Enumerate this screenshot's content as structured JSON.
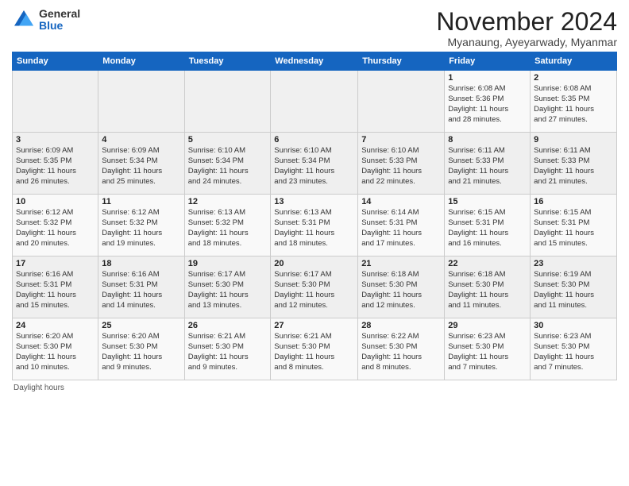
{
  "logo": {
    "general": "General",
    "blue": "Blue"
  },
  "header": {
    "month": "November 2024",
    "location": "Myanaung, Ayeyarwady, Myanmar"
  },
  "weekdays": [
    "Sunday",
    "Monday",
    "Tuesday",
    "Wednesday",
    "Thursday",
    "Friday",
    "Saturday"
  ],
  "footer": "Daylight hours",
  "weeks": [
    [
      {
        "day": "",
        "info": ""
      },
      {
        "day": "",
        "info": ""
      },
      {
        "day": "",
        "info": ""
      },
      {
        "day": "",
        "info": ""
      },
      {
        "day": "",
        "info": ""
      },
      {
        "day": "1",
        "info": "Sunrise: 6:08 AM\nSunset: 5:36 PM\nDaylight: 11 hours\nand 28 minutes."
      },
      {
        "day": "2",
        "info": "Sunrise: 6:08 AM\nSunset: 5:35 PM\nDaylight: 11 hours\nand 27 minutes."
      }
    ],
    [
      {
        "day": "3",
        "info": "Sunrise: 6:09 AM\nSunset: 5:35 PM\nDaylight: 11 hours\nand 26 minutes."
      },
      {
        "day": "4",
        "info": "Sunrise: 6:09 AM\nSunset: 5:34 PM\nDaylight: 11 hours\nand 25 minutes."
      },
      {
        "day": "5",
        "info": "Sunrise: 6:10 AM\nSunset: 5:34 PM\nDaylight: 11 hours\nand 24 minutes."
      },
      {
        "day": "6",
        "info": "Sunrise: 6:10 AM\nSunset: 5:34 PM\nDaylight: 11 hours\nand 23 minutes."
      },
      {
        "day": "7",
        "info": "Sunrise: 6:10 AM\nSunset: 5:33 PM\nDaylight: 11 hours\nand 22 minutes."
      },
      {
        "day": "8",
        "info": "Sunrise: 6:11 AM\nSunset: 5:33 PM\nDaylight: 11 hours\nand 21 minutes."
      },
      {
        "day": "9",
        "info": "Sunrise: 6:11 AM\nSunset: 5:33 PM\nDaylight: 11 hours\nand 21 minutes."
      }
    ],
    [
      {
        "day": "10",
        "info": "Sunrise: 6:12 AM\nSunset: 5:32 PM\nDaylight: 11 hours\nand 20 minutes."
      },
      {
        "day": "11",
        "info": "Sunrise: 6:12 AM\nSunset: 5:32 PM\nDaylight: 11 hours\nand 19 minutes."
      },
      {
        "day": "12",
        "info": "Sunrise: 6:13 AM\nSunset: 5:32 PM\nDaylight: 11 hours\nand 18 minutes."
      },
      {
        "day": "13",
        "info": "Sunrise: 6:13 AM\nSunset: 5:31 PM\nDaylight: 11 hours\nand 18 minutes."
      },
      {
        "day": "14",
        "info": "Sunrise: 6:14 AM\nSunset: 5:31 PM\nDaylight: 11 hours\nand 17 minutes."
      },
      {
        "day": "15",
        "info": "Sunrise: 6:15 AM\nSunset: 5:31 PM\nDaylight: 11 hours\nand 16 minutes."
      },
      {
        "day": "16",
        "info": "Sunrise: 6:15 AM\nSunset: 5:31 PM\nDaylight: 11 hours\nand 15 minutes."
      }
    ],
    [
      {
        "day": "17",
        "info": "Sunrise: 6:16 AM\nSunset: 5:31 PM\nDaylight: 11 hours\nand 15 minutes."
      },
      {
        "day": "18",
        "info": "Sunrise: 6:16 AM\nSunset: 5:31 PM\nDaylight: 11 hours\nand 14 minutes."
      },
      {
        "day": "19",
        "info": "Sunrise: 6:17 AM\nSunset: 5:30 PM\nDaylight: 11 hours\nand 13 minutes."
      },
      {
        "day": "20",
        "info": "Sunrise: 6:17 AM\nSunset: 5:30 PM\nDaylight: 11 hours\nand 12 minutes."
      },
      {
        "day": "21",
        "info": "Sunrise: 6:18 AM\nSunset: 5:30 PM\nDaylight: 11 hours\nand 12 minutes."
      },
      {
        "day": "22",
        "info": "Sunrise: 6:18 AM\nSunset: 5:30 PM\nDaylight: 11 hours\nand 11 minutes."
      },
      {
        "day": "23",
        "info": "Sunrise: 6:19 AM\nSunset: 5:30 PM\nDaylight: 11 hours\nand 11 minutes."
      }
    ],
    [
      {
        "day": "24",
        "info": "Sunrise: 6:20 AM\nSunset: 5:30 PM\nDaylight: 11 hours\nand 10 minutes."
      },
      {
        "day": "25",
        "info": "Sunrise: 6:20 AM\nSunset: 5:30 PM\nDaylight: 11 hours\nand 9 minutes."
      },
      {
        "day": "26",
        "info": "Sunrise: 6:21 AM\nSunset: 5:30 PM\nDaylight: 11 hours\nand 9 minutes."
      },
      {
        "day": "27",
        "info": "Sunrise: 6:21 AM\nSunset: 5:30 PM\nDaylight: 11 hours\nand 8 minutes."
      },
      {
        "day": "28",
        "info": "Sunrise: 6:22 AM\nSunset: 5:30 PM\nDaylight: 11 hours\nand 8 minutes."
      },
      {
        "day": "29",
        "info": "Sunrise: 6:23 AM\nSunset: 5:30 PM\nDaylight: 11 hours\nand 7 minutes."
      },
      {
        "day": "30",
        "info": "Sunrise: 6:23 AM\nSunset: 5:30 PM\nDaylight: 11 hours\nand 7 minutes."
      }
    ]
  ]
}
